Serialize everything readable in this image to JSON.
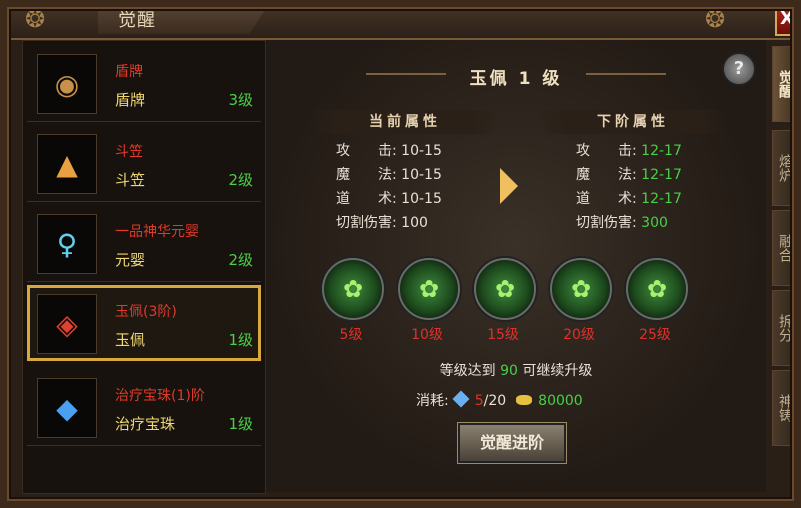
{
  "window": {
    "title": "觉醒",
    "close_label": "X"
  },
  "list": [
    {
      "name": "盾牌",
      "sub": "盾牌",
      "level": "3级",
      "icon": "round-shield-icon",
      "glyph": "◉"
    },
    {
      "name": "斗笠",
      "sub": "斗笠",
      "level": "2级",
      "icon": "straw-hat-icon",
      "glyph": "▲"
    },
    {
      "name": "一品神华元婴",
      "sub": "元婴",
      "level": "2级",
      "icon": "spirit-figure-icon",
      "glyph": "♀"
    },
    {
      "name": "玉佩(3阶)",
      "sub": "玉佩",
      "level": "1级",
      "icon": "jade-pendant-icon",
      "glyph": "◈"
    },
    {
      "name": "治疗宝珠(1)阶",
      "sub": "治疗宝珠",
      "level": "1级",
      "icon": "blue-gem-icon",
      "glyph": "◆"
    }
  ],
  "main": {
    "title": "玉佩 1 级",
    "help_label": "?",
    "current_header": "当前属性",
    "next_header": "下阶属性",
    "current_attrs": [
      {
        "label": "攻　　击:",
        "value": "10-15"
      },
      {
        "label": "魔　　法:",
        "value": "10-15"
      },
      {
        "label": "道　　术:",
        "value": "10-15"
      },
      {
        "label": "切割伤害:",
        "value": "100"
      }
    ],
    "next_attrs": [
      {
        "label": "攻　　击:",
        "value": "12-17"
      },
      {
        "label": "魔　　法:",
        "value": "12-17"
      },
      {
        "label": "道　　术:",
        "value": "12-17"
      },
      {
        "label": "切割伤害:",
        "value": "300"
      }
    ],
    "stages": [
      "5级",
      "10级",
      "15级",
      "20级",
      "25级"
    ],
    "notice_pre": "等级达到",
    "notice_num": "90",
    "notice_post": "可继续升级",
    "cost_label": "消耗:",
    "cost_have": "5",
    "cost_need": "/20",
    "gold": "80000",
    "action_label": "觉醒进阶"
  },
  "side_tabs": [
    "觉醒",
    "熔炉",
    "融合",
    "拆分",
    "神铸"
  ],
  "colors": {
    "level_green": "#48d048",
    "name_red": "#e03a2a",
    "sub_yellow": "#f0d870",
    "selected_border": "#d6a93a"
  }
}
